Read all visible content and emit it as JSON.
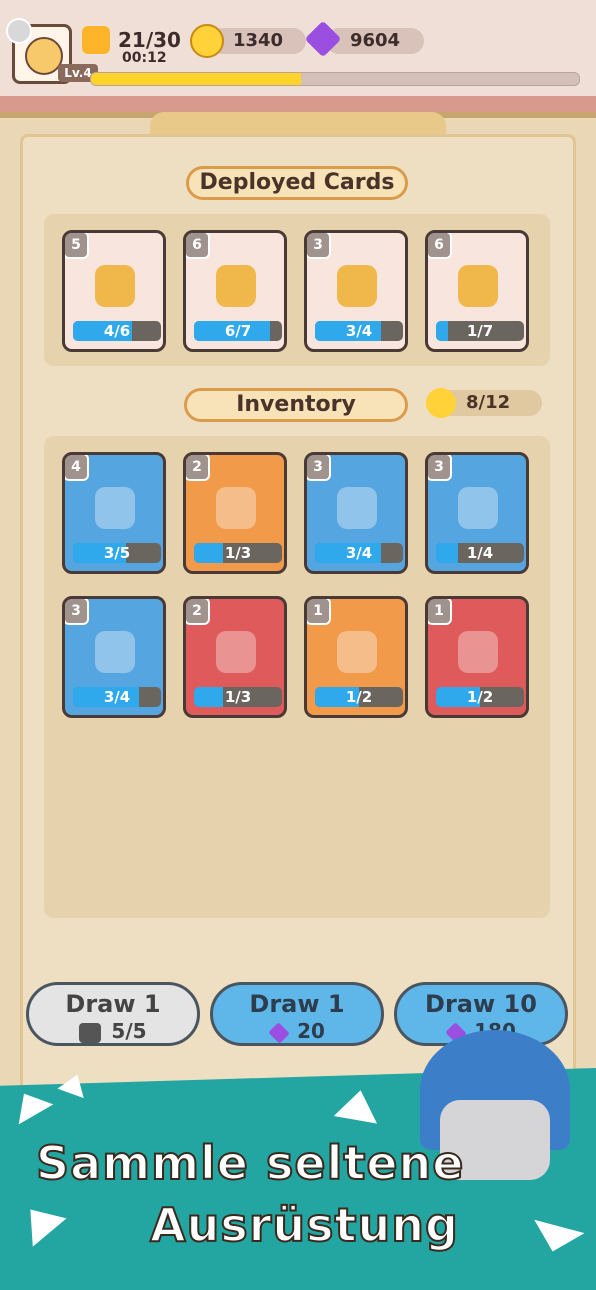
{
  "player": {
    "level": "Lv.4"
  },
  "resources": {
    "energy": "21/30",
    "energy_timer": "00:12",
    "coins": "1340",
    "gems": "9604"
  },
  "xp_progress_percent": 43,
  "deployed": {
    "title": "Deployed Cards",
    "cards": [
      {
        "level": "5",
        "progress": "4/6",
        "fill": 0.67,
        "color": "white",
        "icon": "shield-plus-icon"
      },
      {
        "level": "6",
        "progress": "6/7",
        "fill": 0.86,
        "color": "white",
        "icon": "gear-arrows-icon"
      },
      {
        "level": "3",
        "progress": "3/4",
        "fill": 0.75,
        "color": "white",
        "icon": "hammer-tower-icon"
      },
      {
        "level": "6",
        "progress": "1/7",
        "fill": 0.14,
        "color": "white",
        "icon": "level-up-crown-icon"
      }
    ]
  },
  "inventory": {
    "title": "Inventory",
    "count": "8/12",
    "cards": [
      {
        "level": "4",
        "progress": "3/5",
        "fill": 0.6,
        "color": "blue",
        "icon": "coin-bag-icon"
      },
      {
        "level": "2",
        "progress": "1/3",
        "fill": 0.33,
        "color": "orange",
        "icon": "fire-creature-icon"
      },
      {
        "level": "3",
        "progress": "3/4",
        "fill": 0.75,
        "color": "blue",
        "icon": "mystery-unit-icon"
      },
      {
        "level": "3",
        "progress": "1/4",
        "fill": 0.25,
        "color": "blue",
        "icon": "heal-tower-icon"
      },
      {
        "level": "3",
        "progress": "3/4",
        "fill": 0.75,
        "color": "blue",
        "icon": "chain-lightning-icon"
      },
      {
        "level": "2",
        "progress": "1/3",
        "fill": 0.33,
        "color": "red",
        "icon": "lightning-bolt-icon"
      },
      {
        "level": "1",
        "progress": "1/2",
        "fill": 0.5,
        "color": "orange",
        "icon": "dash-hero-icon"
      },
      {
        "level": "1",
        "progress": "1/2",
        "fill": 0.5,
        "color": "red",
        "icon": "speed-x15-icon"
      }
    ]
  },
  "draw_buttons": [
    {
      "label": "Draw 1",
      "cost": "5/5",
      "type": "ad"
    },
    {
      "label": "Draw 1",
      "cost": "20",
      "type": "gem"
    },
    {
      "label": "Draw 10",
      "cost": "180",
      "type": "gem"
    }
  ],
  "banner": {
    "line1": "Sammle seltene",
    "line2": "Ausrüstung"
  },
  "colors": {
    "white": "#f8e5dd",
    "blue": "#55a5e0",
    "orange": "#f09a4a",
    "red": "#df5a5a",
    "progress": "#2fa8ec",
    "xp": "#ffd42a",
    "banner": "#23a5a1"
  }
}
